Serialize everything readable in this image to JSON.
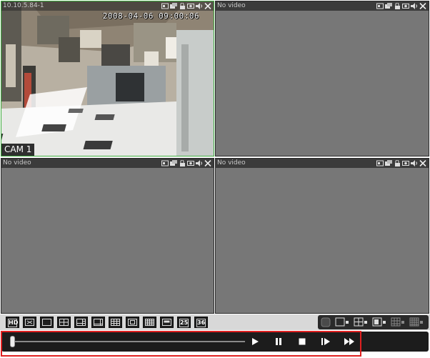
{
  "panes": [
    {
      "title": "10.10.5.84-1",
      "timestamp": "2008-04-06 09:00:06",
      "camera_label": "CAM 1",
      "active": true
    },
    {
      "title": "No video"
    },
    {
      "title": "No video"
    },
    {
      "title": "No video"
    }
  ],
  "pane_icons": [
    "snapshot-icon",
    "record-icon",
    "lock-icon",
    "camera-icon",
    "audio-icon",
    "close-icon"
  ],
  "close_glyph": "✕",
  "layout_toolbar": {
    "buttons": [
      "hd-icon",
      "fullscreen-icon",
      "layout-1-icon",
      "layout-4-icon",
      "layout-6-icon",
      "layout-8-icon",
      "layout-9-icon",
      "layout-13-icon",
      "layout-16-icon",
      "layout-20-icon",
      "layout-25",
      "layout-36"
    ],
    "hd_label": "HD",
    "layout_25_label": "25",
    "layout_36_label": "36"
  },
  "playback": {
    "progress": 0,
    "buttons": [
      "play-icon",
      "pause-icon",
      "stop-icon",
      "step-forward-icon",
      "fast-forward-icon"
    ]
  },
  "colors": {
    "active_border": "#3fae3f",
    "highlight": "#e02020",
    "pane_bg": "#777777"
  }
}
